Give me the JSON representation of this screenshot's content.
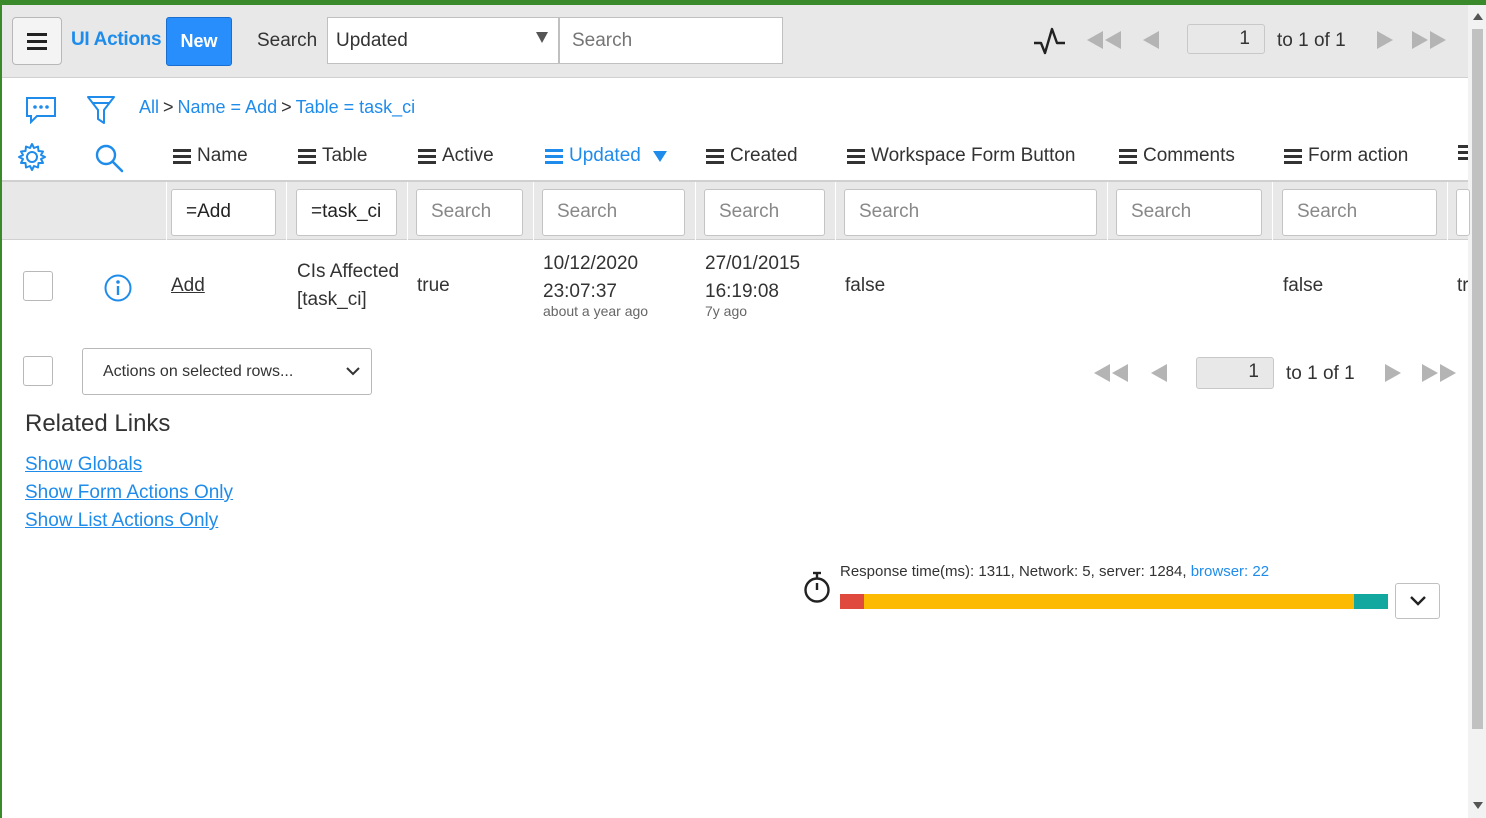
{
  "header": {
    "list_title": "UI Actions",
    "new_label": "New",
    "search_label": "Search",
    "search_field_value": "Updated",
    "search_placeholder": "Search",
    "page_current": "1",
    "page_of": "to 1 of 1"
  },
  "breadcrumb": {
    "all": "All",
    "sep": ">",
    "items": [
      "Name = Add",
      "Table = task_ci"
    ]
  },
  "columns": [
    {
      "label": "Name"
    },
    {
      "label": "Table"
    },
    {
      "label": "Active"
    },
    {
      "label": "Updated",
      "sorted": "desc"
    },
    {
      "label": "Created"
    },
    {
      "label": "Workspace Form Button"
    },
    {
      "label": "Comments"
    },
    {
      "label": "Form action"
    }
  ],
  "filters": {
    "name": "=Add",
    "table": "=task_ci",
    "placeholder": "Search"
  },
  "rows": [
    {
      "name": "Add",
      "table_line1": "CIs Affected",
      "table_line2": "[task_ci]",
      "active": "true",
      "updated_date": "10/12/2020",
      "updated_time": "23:07:37",
      "updated_rel": "about a year ago",
      "created_date": "27/01/2015",
      "created_time": "16:19:08",
      "created_rel": "7y ago",
      "workspace_form_button": "false",
      "comments": "",
      "form_action": "false",
      "overflow": "tr"
    }
  ],
  "footer": {
    "actions_label": "Actions on selected rows...",
    "page_current": "1",
    "page_of": "to 1 of 1"
  },
  "related_links": {
    "title": "Related Links",
    "links": [
      "Show Globals",
      "Show Form Actions Only",
      "Show List Actions Only"
    ]
  },
  "response": {
    "text": "Response time(ms): 1311, Network: 5, server: 1284,",
    "browser": "browser: 22",
    "network_ms": 5,
    "server_ms": 1284,
    "browser_ms": 22,
    "colors": {
      "network": "#e04a3e",
      "server": "#fcba03",
      "browser": "#12a8a0"
    }
  },
  "colors": {
    "accent": "#1f8ceb",
    "brand_bar": "#3a8a2c",
    "new_button": "#278efc"
  }
}
